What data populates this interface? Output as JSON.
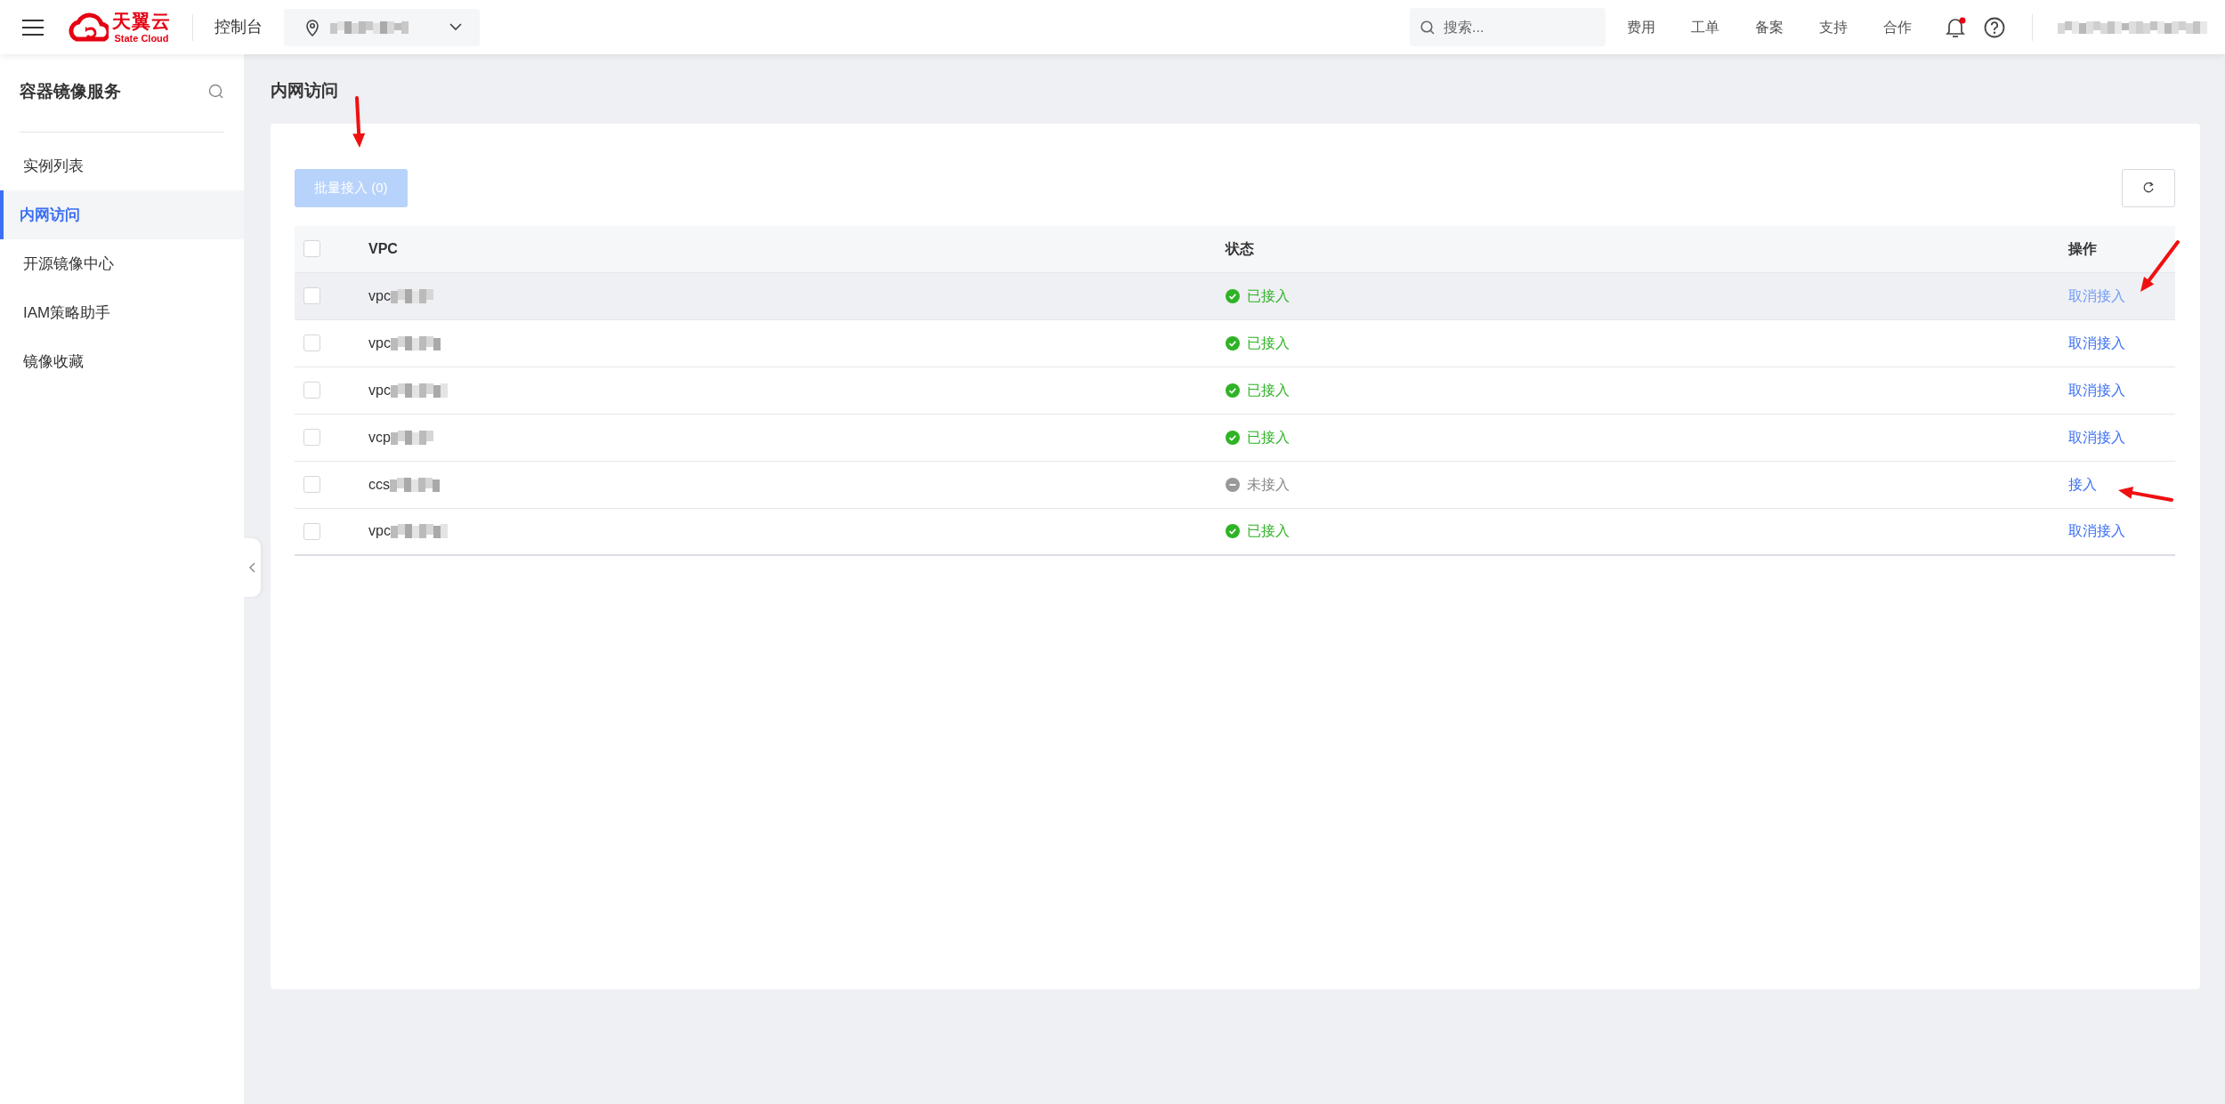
{
  "topbar": {
    "logo": {
      "name": "天翼云",
      "tagline": "State Cloud"
    },
    "console": "控制台",
    "region": {
      "redacted": true
    },
    "search": {
      "placeholder": "搜索..."
    },
    "links": [
      "费用",
      "工单",
      "备案",
      "支持",
      "合作"
    ],
    "notification": {
      "unread": true
    },
    "user": {
      "redacted": true
    }
  },
  "sidebar": {
    "title": "容器镜像服务",
    "items": [
      {
        "label": "实例列表",
        "selected": false
      },
      {
        "label": "内网访问",
        "selected": true
      },
      {
        "label": "开源镜像中心",
        "selected": false
      },
      {
        "label": "IAM策略助手",
        "selected": false
      },
      {
        "label": "镜像收藏",
        "selected": false
      }
    ]
  },
  "page": {
    "title": "内网访问"
  },
  "toolbar": {
    "batch_button": {
      "label": "批量接入 (0)",
      "disabled": true
    }
  },
  "table": {
    "columns": [
      "VPC",
      "状态",
      "操作"
    ],
    "all_checked": false,
    "rows": [
      {
        "checked": false,
        "hovered": true,
        "vpc": "vpc",
        "redacted": true,
        "status": "已接入",
        "connected": true,
        "action": "取消接入"
      },
      {
        "checked": false,
        "hovered": false,
        "vpc": "vpc",
        "redacted": true,
        "status": "已接入",
        "connected": true,
        "action": "取消接入"
      },
      {
        "checked": false,
        "hovered": false,
        "vpc": "vpc",
        "redacted": true,
        "status": "已接入",
        "connected": true,
        "action": "取消接入"
      },
      {
        "checked": false,
        "hovered": false,
        "vpc": "vcp",
        "redacted": true,
        "status": "已接入",
        "connected": true,
        "action": "取消接入"
      },
      {
        "checked": false,
        "hovered": false,
        "vpc": "ccs",
        "redacted": true,
        "status": "未接入",
        "connected": false,
        "action": "接入"
      },
      {
        "checked": false,
        "hovered": false,
        "vpc": "vpc",
        "redacted": true,
        "status": "已接入",
        "connected": true,
        "action": "取消接入"
      }
    ]
  },
  "annotations": [
    {
      "kind": "arrow-down"
    },
    {
      "kind": "arrow-down-left"
    },
    {
      "kind": "arrow-left"
    }
  ]
}
